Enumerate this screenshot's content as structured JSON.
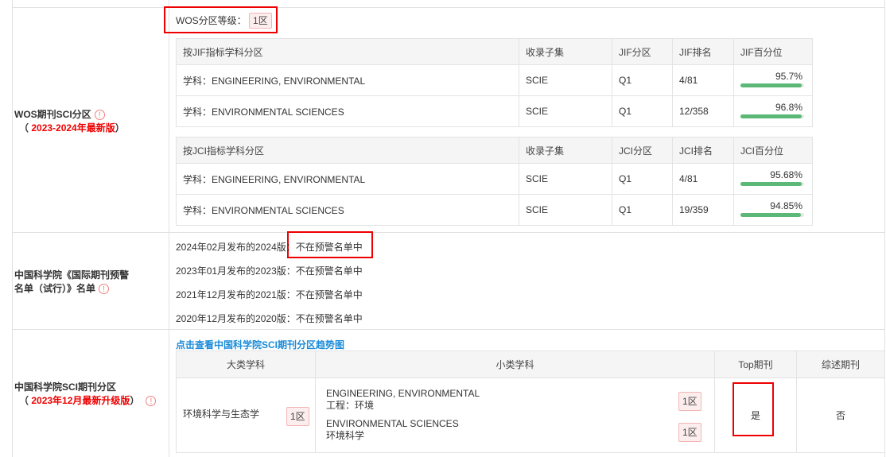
{
  "wos_section": {
    "label": "WOS期刊SCI分区",
    "sub_label": "2023-2024年最新版",
    "level_label": "WOS分区等级：",
    "level_value": "1区",
    "jif_table": {
      "headers": [
        "按JIF指标学科分区",
        "收录子集",
        "JIF分区",
        "JIF排名",
        "JIF百分位"
      ],
      "rows": [
        {
          "subject": "学科：ENGINEERING, ENVIRONMENTAL",
          "subset": "SCIE",
          "quartile": "Q1",
          "rank": "4/81",
          "percentile": "95.7%",
          "percentile_value": 95.7
        },
        {
          "subject": "学科：ENVIRONMENTAL SCIENCES",
          "subset": "SCIE",
          "quartile": "Q1",
          "rank": "12/358",
          "percentile": "96.8%",
          "percentile_value": 96.8
        }
      ]
    },
    "jci_table": {
      "headers": [
        "按JCI指标学科分区",
        "收录子集",
        "JCI分区",
        "JCI排名",
        "JCI百分位"
      ],
      "rows": [
        {
          "subject": "学科：ENGINEERING, ENVIRONMENTAL",
          "subset": "SCIE",
          "quartile": "Q1",
          "rank": "4/81",
          "percentile": "95.68%",
          "percentile_value": 95.68
        },
        {
          "subject": "学科：ENVIRONMENTAL SCIENCES",
          "subset": "SCIE",
          "quartile": "Q1",
          "rank": "19/359",
          "percentile": "94.85%",
          "percentile_value": 94.85
        }
      ]
    }
  },
  "warning_section": {
    "label_line1": "中国科学院《国际期刊预警",
    "label_line2": "名单（试行）》名单",
    "entries": [
      {
        "prefix": "2024年02月发布的2024版：",
        "status": "不在预警名单中"
      },
      {
        "prefix": "2023年01月发布的2023版：",
        "status": "不在预警名单中"
      },
      {
        "prefix": "2021年12月发布的2021版：",
        "status": "不在预警名单中"
      },
      {
        "prefix": "2020年12月发布的2020版：",
        "status": "不在预警名单中"
      }
    ]
  },
  "cas_section": {
    "label": "中国科学院SCI期刊分区",
    "sub_label": "2023年12月最新升级版",
    "trend_link": "点击查看中国科学院SCI期刊分区趋势图",
    "headers": [
      "大类学科",
      "小类学科",
      "Top期刊",
      "综述期刊"
    ],
    "major": {
      "name": "环境科学与生态学",
      "zone": "1区"
    },
    "minors": [
      {
        "en": "ENGINEERING, ENVIRONMENTAL",
        "cn": "工程：环境",
        "zone": "1区"
      },
      {
        "en": "ENVIRONMENTAL SCIENCES",
        "cn": "环境科学",
        "zone": "1区"
      }
    ],
    "top": "是",
    "review": "否"
  },
  "icons": {
    "info": "info-icon"
  },
  "colors": {
    "accent_red": "#e00000",
    "link_blue": "#1a8bd8",
    "bar_green": "#5cb877"
  }
}
